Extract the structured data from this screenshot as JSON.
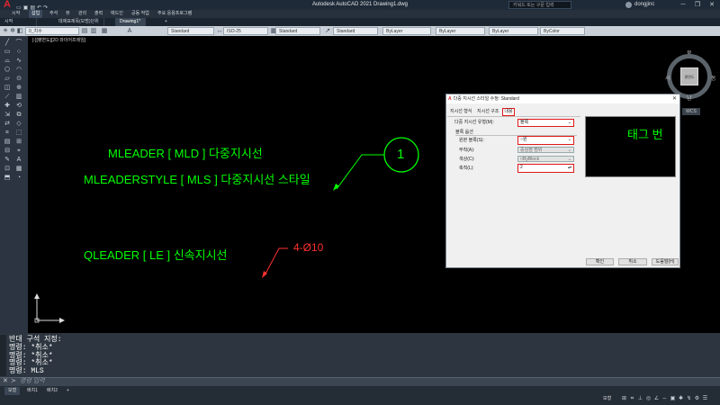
{
  "titlebar": {
    "app_title": "Autodesk AutoCAD 2021    Drawing1.dwg",
    "search_placeholder": "키워드 또는 구문 입력",
    "user": "dongjinc",
    "minimize": "─",
    "restore": "❐",
    "close": "✕"
  },
  "ribbon_tabs": [
    "시작",
    "삽입",
    "주석",
    "뷰",
    "관리",
    "출력",
    "애드인",
    "공동 작업",
    "주요 응용프로그램"
  ],
  "doc_tabs": {
    "tab1": "데제표제목(모범)단위",
    "tab2": "Drawing1*",
    "add": "+"
  },
  "toolbar": {
    "layer_name": "0_치수",
    "text_style": "Standard",
    "dim_style": "ISO-25",
    "table_style": "Standard",
    "mleader_style": "Standard",
    "color": "ByLayer",
    "linetype": "ByLayer",
    "lineweight": "ByLayer",
    "plot_style": "ByColor"
  },
  "viewport": {
    "label": "[-][평면도][2D 와이어프레임]",
    "texts": [
      "MLEADER [ MLD ] 다중지시선",
      "MLEADERSTYLE [ MLS ] 다중지시선 스타일",
      "QLEADER [ LE ] 신속지시선"
    ],
    "balloon_number": "1",
    "leader_note": "4-Ø10"
  },
  "viewcube": {
    "face": "평면도",
    "west": "서",
    "east": "동",
    "south": "남",
    "north": "북",
    "wcs": "WCS"
  },
  "command": {
    "lines": [
      "반대 구석 지정:",
      "명령: *취소*",
      "명령: *취소*",
      "명령: *취소*",
      "명령: MLS"
    ],
    "input_placeholder": "명령 입력",
    "prompt_icon": "≻"
  },
  "status": {
    "tabs": [
      "모형",
      "배치1",
      "배치2"
    ],
    "model": "모형"
  },
  "dialog": {
    "title": "다중 지시선 스타일 수정: Standard",
    "tabs": [
      "지시선 형식",
      "지시선 구조",
      "내용"
    ],
    "content_type_label": "다중 지시선 유형(M):",
    "content_type_value": "블록",
    "block_options_header": "블록 옵션",
    "source_block_label": "원본 블록(S):",
    "source_block_value": "원",
    "attachment_label": "부착(A):",
    "attachment_value": "중심점 범위",
    "color_label": "색상(C):",
    "color_value": "ByBlock",
    "scale_label": "축척(L):",
    "scale_value": "2",
    "preview_text": "태그 번",
    "ok": "확인",
    "cancel": "취소",
    "help": "도움말(H)"
  }
}
